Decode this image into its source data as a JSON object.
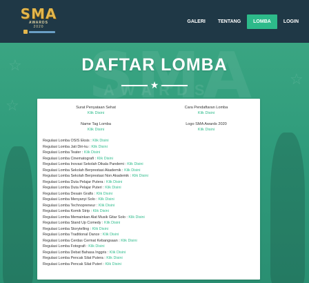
{
  "brand": {
    "logo_text": "SMA",
    "logo_subtitle": "AWARDS",
    "logo_year": "2020",
    "accent": "#2dba8a",
    "nav_bg": "#1f3846",
    "logo_gold": "#e3b64c"
  },
  "nav": {
    "items": [
      {
        "label": "GALERI",
        "active": false
      },
      {
        "label": "TENTANG",
        "active": false
      },
      {
        "label": "LOMBA",
        "active": true
      },
      {
        "label": "LOGIN",
        "active": false
      }
    ]
  },
  "hero": {
    "title": "DAFTAR LOMBA",
    "background_text": "SMA",
    "background_subtext": "AWARDS"
  },
  "documents": [
    {
      "name": "Surat Penyataan Sehat",
      "link": "Klik Disini"
    },
    {
      "name": "Cara Pendaftaran Lomba",
      "link": "Klik Disini"
    },
    {
      "name": "Name Tag Lomba",
      "link": "Klik Disini"
    },
    {
      "name": "Logo SMA Awards 2020",
      "link": "Klik Disini"
    }
  ],
  "link_label": "Klik Disini",
  "rules": [
    "Regulasi Lomba OSIS Eksis : ",
    "Regulasi Lomba Jati Diri-ku : ",
    "Regulasi Lomba Teater : ",
    "Regulasi Lomba Cinematografi : ",
    "Regulasi Lomba Inovasi Sekolah Dikala Pandemi : ",
    "Regulasi Lomba Sekolah Berprestasi Akademik : ",
    "Regulasi Lomba Sekolah Berprestasi Non Akademik : ",
    "Regulasi Lomba Duta Pelajar Putera : ",
    "Regulasi Lomba Duta Pelajar Puteri : ",
    "Regulasi Lomba Desain Grafis : ",
    "Regulasi Lomba Menyanyi Solo : ",
    "Regulasi Lomba Technopreneur : ",
    "Regulasi Lomba Komik Strip : ",
    "Regulasi Lomba Memainkan Alat Musik Gitar Solo : ",
    "Regulasi Lomba Stand Up Comedy : ",
    "Regulasi Lomba Storytelling : ",
    "Regulasi Lomba Traditional Dance : ",
    "Regulasi Lomba Cerdas Cermat Kebangsaan : ",
    "Regulasi Lomba Fotografi : ",
    "Regulasi Lomba Debat Bahasa Inggris : ",
    "Regulasi Lomba Pencak Silat Putera : ",
    "Regulasi Lomba Pencak Silat Puteri : "
  ]
}
